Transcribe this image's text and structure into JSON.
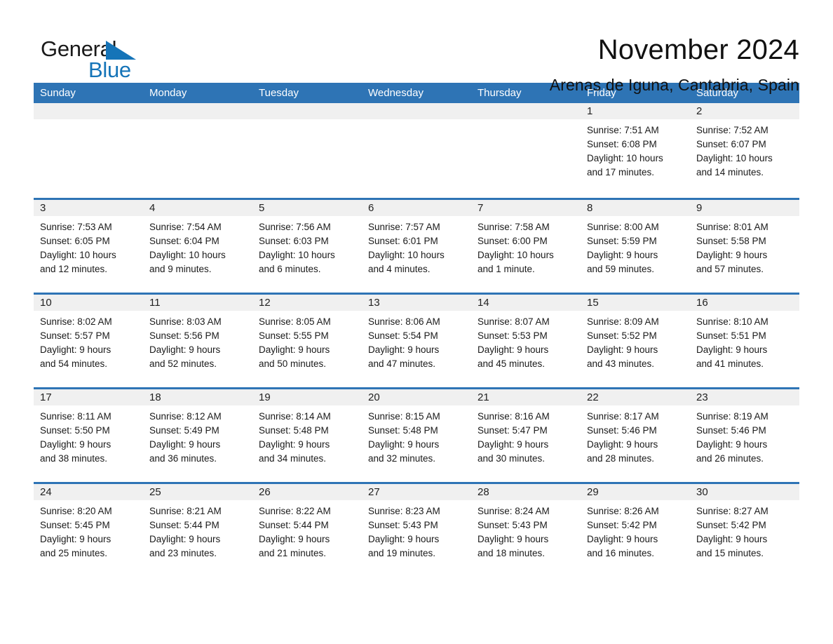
{
  "brand": {
    "name_part1": "General",
    "name_part2": "Blue",
    "triangle_icon": "triangle-icon"
  },
  "header": {
    "month_title": "November 2024",
    "location": "Arenas de Iguna, Cantabria, Spain"
  },
  "colors": {
    "header_blue": "#2e74b5",
    "logo_blue": "#1574b8",
    "date_band_gray": "#f0f0f0",
    "text_black": "#1a1a1a"
  },
  "calendar": {
    "weekdays": [
      "Sunday",
      "Monday",
      "Tuesday",
      "Wednesday",
      "Thursday",
      "Friday",
      "Saturday"
    ],
    "weeks": [
      [
        {
          "day": "",
          "sunrise": "",
          "sunset": "",
          "daylight_line1": "",
          "daylight_line2": ""
        },
        {
          "day": "",
          "sunrise": "",
          "sunset": "",
          "daylight_line1": "",
          "daylight_line2": ""
        },
        {
          "day": "",
          "sunrise": "",
          "sunset": "",
          "daylight_line1": "",
          "daylight_line2": ""
        },
        {
          "day": "",
          "sunrise": "",
          "sunset": "",
          "daylight_line1": "",
          "daylight_line2": ""
        },
        {
          "day": "",
          "sunrise": "",
          "sunset": "",
          "daylight_line1": "",
          "daylight_line2": ""
        },
        {
          "day": "1",
          "sunrise": "Sunrise: 7:51 AM",
          "sunset": "Sunset: 6:08 PM",
          "daylight_line1": "Daylight: 10 hours",
          "daylight_line2": "and 17 minutes."
        },
        {
          "day": "2",
          "sunrise": "Sunrise: 7:52 AM",
          "sunset": "Sunset: 6:07 PM",
          "daylight_line1": "Daylight: 10 hours",
          "daylight_line2": "and 14 minutes."
        }
      ],
      [
        {
          "day": "3",
          "sunrise": "Sunrise: 7:53 AM",
          "sunset": "Sunset: 6:05 PM",
          "daylight_line1": "Daylight: 10 hours",
          "daylight_line2": "and 12 minutes."
        },
        {
          "day": "4",
          "sunrise": "Sunrise: 7:54 AM",
          "sunset": "Sunset: 6:04 PM",
          "daylight_line1": "Daylight: 10 hours",
          "daylight_line2": "and 9 minutes."
        },
        {
          "day": "5",
          "sunrise": "Sunrise: 7:56 AM",
          "sunset": "Sunset: 6:03 PM",
          "daylight_line1": "Daylight: 10 hours",
          "daylight_line2": "and 6 minutes."
        },
        {
          "day": "6",
          "sunrise": "Sunrise: 7:57 AM",
          "sunset": "Sunset: 6:01 PM",
          "daylight_line1": "Daylight: 10 hours",
          "daylight_line2": "and 4 minutes."
        },
        {
          "day": "7",
          "sunrise": "Sunrise: 7:58 AM",
          "sunset": "Sunset: 6:00 PM",
          "daylight_line1": "Daylight: 10 hours",
          "daylight_line2": "and 1 minute."
        },
        {
          "day": "8",
          "sunrise": "Sunrise: 8:00 AM",
          "sunset": "Sunset: 5:59 PM",
          "daylight_line1": "Daylight: 9 hours",
          "daylight_line2": "and 59 minutes."
        },
        {
          "day": "9",
          "sunrise": "Sunrise: 8:01 AM",
          "sunset": "Sunset: 5:58 PM",
          "daylight_line1": "Daylight: 9 hours",
          "daylight_line2": "and 57 minutes."
        }
      ],
      [
        {
          "day": "10",
          "sunrise": "Sunrise: 8:02 AM",
          "sunset": "Sunset: 5:57 PM",
          "daylight_line1": "Daylight: 9 hours",
          "daylight_line2": "and 54 minutes."
        },
        {
          "day": "11",
          "sunrise": "Sunrise: 8:03 AM",
          "sunset": "Sunset: 5:56 PM",
          "daylight_line1": "Daylight: 9 hours",
          "daylight_line2": "and 52 minutes."
        },
        {
          "day": "12",
          "sunrise": "Sunrise: 8:05 AM",
          "sunset": "Sunset: 5:55 PM",
          "daylight_line1": "Daylight: 9 hours",
          "daylight_line2": "and 50 minutes."
        },
        {
          "day": "13",
          "sunrise": "Sunrise: 8:06 AM",
          "sunset": "Sunset: 5:54 PM",
          "daylight_line1": "Daylight: 9 hours",
          "daylight_line2": "and 47 minutes."
        },
        {
          "day": "14",
          "sunrise": "Sunrise: 8:07 AM",
          "sunset": "Sunset: 5:53 PM",
          "daylight_line1": "Daylight: 9 hours",
          "daylight_line2": "and 45 minutes."
        },
        {
          "day": "15",
          "sunrise": "Sunrise: 8:09 AM",
          "sunset": "Sunset: 5:52 PM",
          "daylight_line1": "Daylight: 9 hours",
          "daylight_line2": "and 43 minutes."
        },
        {
          "day": "16",
          "sunrise": "Sunrise: 8:10 AM",
          "sunset": "Sunset: 5:51 PM",
          "daylight_line1": "Daylight: 9 hours",
          "daylight_line2": "and 41 minutes."
        }
      ],
      [
        {
          "day": "17",
          "sunrise": "Sunrise: 8:11 AM",
          "sunset": "Sunset: 5:50 PM",
          "daylight_line1": "Daylight: 9 hours",
          "daylight_line2": "and 38 minutes."
        },
        {
          "day": "18",
          "sunrise": "Sunrise: 8:12 AM",
          "sunset": "Sunset: 5:49 PM",
          "daylight_line1": "Daylight: 9 hours",
          "daylight_line2": "and 36 minutes."
        },
        {
          "day": "19",
          "sunrise": "Sunrise: 8:14 AM",
          "sunset": "Sunset: 5:48 PM",
          "daylight_line1": "Daylight: 9 hours",
          "daylight_line2": "and 34 minutes."
        },
        {
          "day": "20",
          "sunrise": "Sunrise: 8:15 AM",
          "sunset": "Sunset: 5:48 PM",
          "daylight_line1": "Daylight: 9 hours",
          "daylight_line2": "and 32 minutes."
        },
        {
          "day": "21",
          "sunrise": "Sunrise: 8:16 AM",
          "sunset": "Sunset: 5:47 PM",
          "daylight_line1": "Daylight: 9 hours",
          "daylight_line2": "and 30 minutes."
        },
        {
          "day": "22",
          "sunrise": "Sunrise: 8:17 AM",
          "sunset": "Sunset: 5:46 PM",
          "daylight_line1": "Daylight: 9 hours",
          "daylight_line2": "and 28 minutes."
        },
        {
          "day": "23",
          "sunrise": "Sunrise: 8:19 AM",
          "sunset": "Sunset: 5:46 PM",
          "daylight_line1": "Daylight: 9 hours",
          "daylight_line2": "and 26 minutes."
        }
      ],
      [
        {
          "day": "24",
          "sunrise": "Sunrise: 8:20 AM",
          "sunset": "Sunset: 5:45 PM",
          "daylight_line1": "Daylight: 9 hours",
          "daylight_line2": "and 25 minutes."
        },
        {
          "day": "25",
          "sunrise": "Sunrise: 8:21 AM",
          "sunset": "Sunset: 5:44 PM",
          "daylight_line1": "Daylight: 9 hours",
          "daylight_line2": "and 23 minutes."
        },
        {
          "day": "26",
          "sunrise": "Sunrise: 8:22 AM",
          "sunset": "Sunset: 5:44 PM",
          "daylight_line1": "Daylight: 9 hours",
          "daylight_line2": "and 21 minutes."
        },
        {
          "day": "27",
          "sunrise": "Sunrise: 8:23 AM",
          "sunset": "Sunset: 5:43 PM",
          "daylight_line1": "Daylight: 9 hours",
          "daylight_line2": "and 19 minutes."
        },
        {
          "day": "28",
          "sunrise": "Sunrise: 8:24 AM",
          "sunset": "Sunset: 5:43 PM",
          "daylight_line1": "Daylight: 9 hours",
          "daylight_line2": "and 18 minutes."
        },
        {
          "day": "29",
          "sunrise": "Sunrise: 8:26 AM",
          "sunset": "Sunset: 5:42 PM",
          "daylight_line1": "Daylight: 9 hours",
          "daylight_line2": "and 16 minutes."
        },
        {
          "day": "30",
          "sunrise": "Sunrise: 8:27 AM",
          "sunset": "Sunset: 5:42 PM",
          "daylight_line1": "Daylight: 9 hours",
          "daylight_line2": "and 15 minutes."
        }
      ]
    ]
  }
}
